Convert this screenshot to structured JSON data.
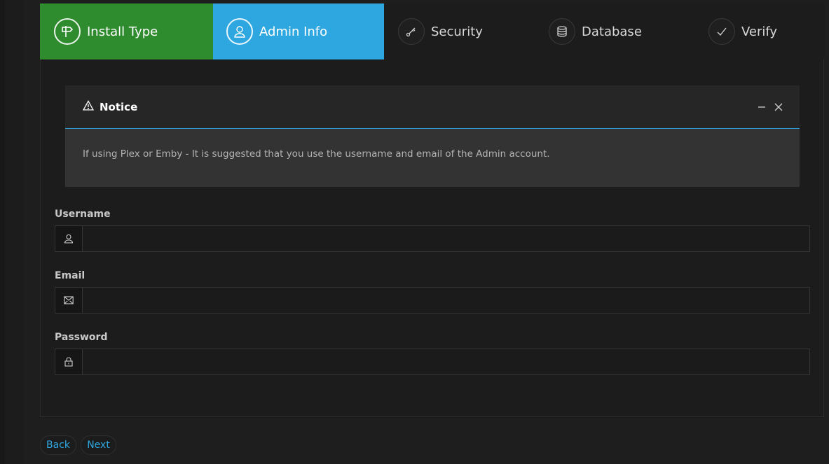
{
  "wizard": {
    "steps": [
      {
        "label": "Install Type",
        "icon": "signpost-icon",
        "state": "done"
      },
      {
        "label": "Admin Info",
        "icon": "user-icon",
        "state": "active"
      },
      {
        "label": "Security",
        "icon": "key-icon",
        "state": "pending"
      },
      {
        "label": "Database",
        "icon": "database-icon",
        "state": "pending"
      },
      {
        "label": "Verify",
        "icon": "check-icon",
        "state": "pending"
      }
    ]
  },
  "notice": {
    "title": "Notice",
    "message": "If using Plex or Emby - It is suggested that you use the username and email of the Admin account."
  },
  "form": {
    "username": {
      "label": "Username",
      "value": "",
      "placeholder": ""
    },
    "email": {
      "label": "Email",
      "value": "",
      "placeholder": ""
    },
    "password": {
      "label": "Password",
      "value": "",
      "placeholder": ""
    }
  },
  "buttons": {
    "back": "Back",
    "next": "Next"
  },
  "colors": {
    "done": "#2e8b2e",
    "active": "#2ea7e0",
    "accent": "#2ea7e0"
  }
}
